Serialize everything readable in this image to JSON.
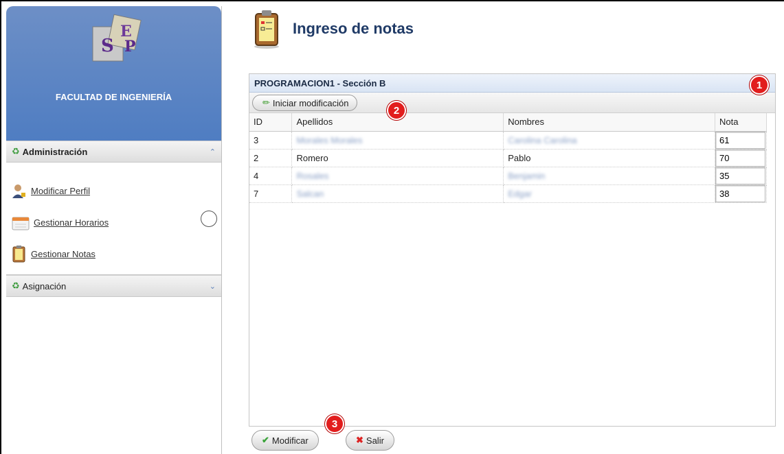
{
  "sidebar": {
    "faculty": "FACULTAD DE INGENIERÍA",
    "sections": [
      {
        "title": "Administración",
        "items": [
          {
            "label": "Modificar Perfil",
            "icon": "user-edit-icon"
          },
          {
            "label": "Gestionar Horarios",
            "icon": "calendar-icon"
          },
          {
            "label": "Gestionar Notas",
            "icon": "clipboard-icon"
          }
        ]
      },
      {
        "title": "Asignación"
      }
    ]
  },
  "header": {
    "title": "Ingreso de notas"
  },
  "panel": {
    "title": "PROGRAMACION1 - Sección B",
    "toolbar_button": "Iniciar modificación",
    "columns": [
      "ID",
      "Apellidos",
      "Nombres",
      "Nota"
    ],
    "rows": [
      {
        "id": "3",
        "apellidos": "Morales Morales",
        "nombres": "Carolina Carolina",
        "nota": "61",
        "blurred": true
      },
      {
        "id": "2",
        "apellidos": "Romero",
        "nombres": "Pablo",
        "nota": "70",
        "blurred": false
      },
      {
        "id": "4",
        "apellidos": "Rosales",
        "nombres": "Benjamin",
        "nota": "35",
        "blurred": true
      },
      {
        "id": "7",
        "apellidos": "Salcan",
        "nombres": "Edgar",
        "nota": "38",
        "blurred": true
      }
    ]
  },
  "footer": {
    "modify_label": "Modificar",
    "exit_label": "Salir"
  },
  "annotations": [
    "1",
    "2",
    "3"
  ],
  "colors": {
    "accent": "#4f7dc2",
    "badge": "#e21d1d",
    "title": "#1f3a66"
  }
}
